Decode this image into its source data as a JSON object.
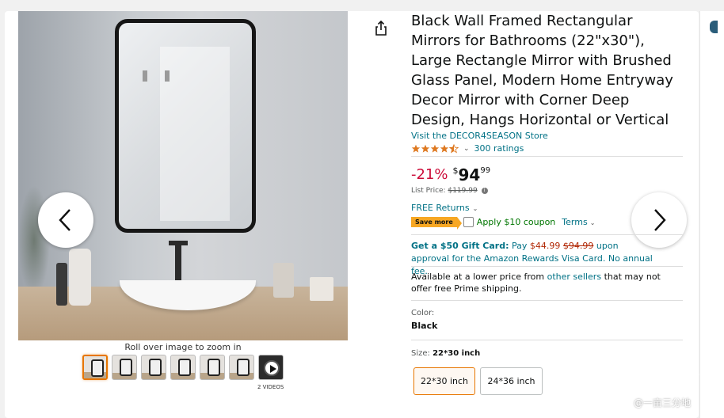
{
  "product": {
    "title": "Black Wall Framed Rectangular Mirrors for Bathrooms (22\"x30\"), Large Rectangle Mirror with Brushed Glass Panel, Modern Home Entryway Decor Mirror with Corner Deep Design, Hangs Horizontal or Vertical",
    "store_link": "Visit the DECOR4SEASON Store",
    "rating_stars": 4.5,
    "rating_count": "300 ratings"
  },
  "price": {
    "discount": "-21%",
    "currency": "$",
    "whole": "94",
    "fraction": "99",
    "list_label": "List Price:",
    "list_price": "$119.99"
  },
  "returns": {
    "label": "FREE Returns"
  },
  "coupon": {
    "badge": "Save more",
    "text": "Apply $10 coupon",
    "terms": "Terms"
  },
  "gift_card": {
    "bold": "Get a $50 Gift Card:",
    "pay": "Pay",
    "new_price": "$44.99",
    "old_price": "$94.99",
    "rest": "upon approval for the Amazon Rewards Visa Card. No annual fee."
  },
  "availability": {
    "pre": "Available at a lower price from",
    "link": "other sellers",
    "post": "that may not offer free Prime shipping."
  },
  "color": {
    "label": "Color:",
    "value": "Black"
  },
  "size": {
    "label": "Size:",
    "value": "22*30 inch",
    "options": [
      "22*30 inch",
      "24*36 inch"
    ],
    "selected": 0
  },
  "gallery": {
    "zoom_caption": "Roll over image to zoom in",
    "videos_label": "2 VIDEOS",
    "thumb_count": 7,
    "active_index": 0
  },
  "icons": {
    "share": "share-icon",
    "prev": "chevron-left-icon",
    "next": "chevron-right-icon",
    "info": "info-icon"
  },
  "colors": {
    "link": "#007185",
    "discount": "#cc0c39",
    "badge": "#f7a723",
    "coupon_green": "#007600",
    "selected_border": "#e77600"
  },
  "watermark": {
    "text": "@一亩三分地"
  }
}
